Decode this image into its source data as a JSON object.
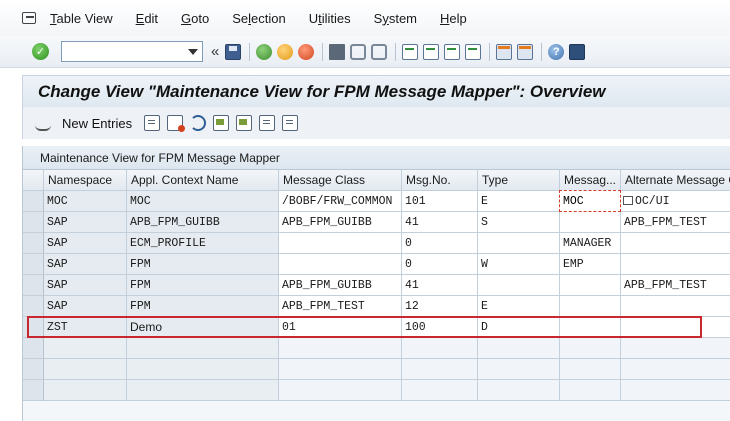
{
  "menu": {
    "items": [
      {
        "label": "Table View",
        "underline": "T"
      },
      {
        "label": "Edit",
        "underline": "E"
      },
      {
        "label": "Goto",
        "underline": "G"
      },
      {
        "label": "Selection",
        "underline": "l"
      },
      {
        "label": "Utilities",
        "underline": "t"
      },
      {
        "label": "System",
        "underline": "y"
      },
      {
        "label": "Help",
        "underline": "H"
      }
    ]
  },
  "std_toolbar": {
    "command_value": "",
    "collapse_glyph": "«",
    "help_glyph": "?"
  },
  "title": "Change View \"Maintenance View for FPM Message Mapper\": Overview",
  "app_toolbar": {
    "new_entries_label": "New Entries"
  },
  "table": {
    "caption": "Maintenance View for FPM Message Mapper",
    "columns": [
      "Namespace",
      "Appl. Context Name",
      "Message Class",
      "Msg.No.",
      "Type",
      "Messag...",
      "Alternate Message C"
    ],
    "rows": [
      [
        "MOC",
        "MOC",
        "/BOBF/FRW_COMMON",
        "101",
        "E",
        "MOC",
        "OC/UI"
      ],
      [
        "SAP",
        "APB_FPM_GUIBB",
        "APB_FPM_GUIBB",
        "41",
        "S",
        "",
        "APB_FPM_TEST"
      ],
      [
        "SAP",
        "ECM_PROFILE",
        "",
        "0",
        "",
        "MANAGER",
        ""
      ],
      [
        "SAP",
        "FPM",
        "",
        "0",
        "W",
        "EMP",
        ""
      ],
      [
        "SAP",
        "FPM",
        "APB_FPM_GUIBB",
        "41",
        "",
        "",
        "APB_FPM_TEST"
      ],
      [
        "SAP",
        "FPM",
        "APB_FPM_TEST",
        "12",
        "E",
        "",
        ""
      ],
      [
        "ZST",
        "Demo",
        "01",
        "100",
        "D",
        "",
        ""
      ]
    ],
    "empty_rows": 3
  },
  "colors": {
    "highlight": "#c8282d",
    "title_bg": "#dfe8f1",
    "readonly_cell": "#e5ebf1"
  }
}
